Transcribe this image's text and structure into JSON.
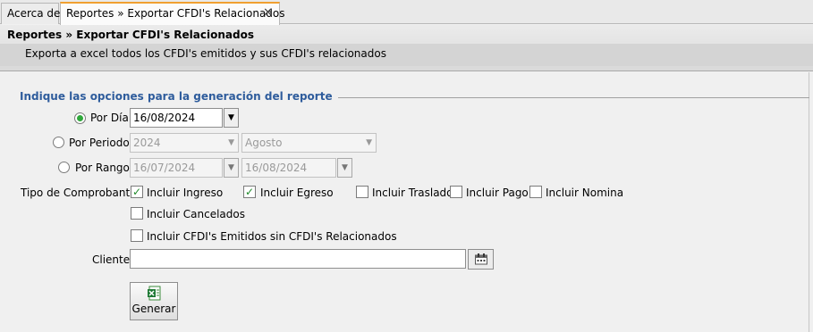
{
  "tabs": [
    {
      "label": "Acerca de"
    },
    {
      "label": "Reportes » Exportar CFDI's Relacionados",
      "close": "✕"
    }
  ],
  "header": {
    "title": "Reportes » Exportar CFDI's Relacionados",
    "subtitle": "Exporta a excel todos los CFDI's emitidos y sus CFDI's relacionados"
  },
  "form": {
    "legend": "Indique las opciones para la generación del reporte",
    "por_dia": {
      "label": "Por Día",
      "value": "16/08/2024",
      "selected": true
    },
    "por_periodo": {
      "label": "Por Periodo",
      "year": "2024",
      "month": "Agosto",
      "selected": false
    },
    "por_rango": {
      "label": "Por Rango",
      "from": "16/07/2024",
      "to": "16/08/2024",
      "selected": false
    },
    "tipo_label": "Tipo de Comprobante",
    "checks": {
      "ingreso": {
        "label": "Incluir Ingreso",
        "checked": true
      },
      "egreso": {
        "label": "Incluir Egreso",
        "checked": true
      },
      "traslado": {
        "label": "Incluir Traslado",
        "checked": false
      },
      "pago": {
        "label": "Incluir Pago",
        "checked": false
      },
      "nomina": {
        "label": "Incluir Nomina",
        "checked": false
      },
      "cancelados": {
        "label": "Incluir Cancelados",
        "checked": false
      },
      "sin_relacionados": {
        "label": "Incluir CFDI's Emitidos sin CFDI's Relacionados",
        "checked": false
      }
    },
    "cliente_label": "Cliente",
    "cliente_value": "",
    "generate_label": "Generar",
    "check_mark": "✓",
    "dropdown_arrow": "▼"
  },
  "colors": {
    "accent": "#2e5c9c",
    "radio_on": "#2fa83b",
    "check": "#1f8a2a",
    "tab_active": "#f0a030"
  },
  "icons": [
    "close-icon",
    "dropdown-arrow-icon",
    "calendar-binoculars-icon",
    "excel-export-icon"
  ]
}
